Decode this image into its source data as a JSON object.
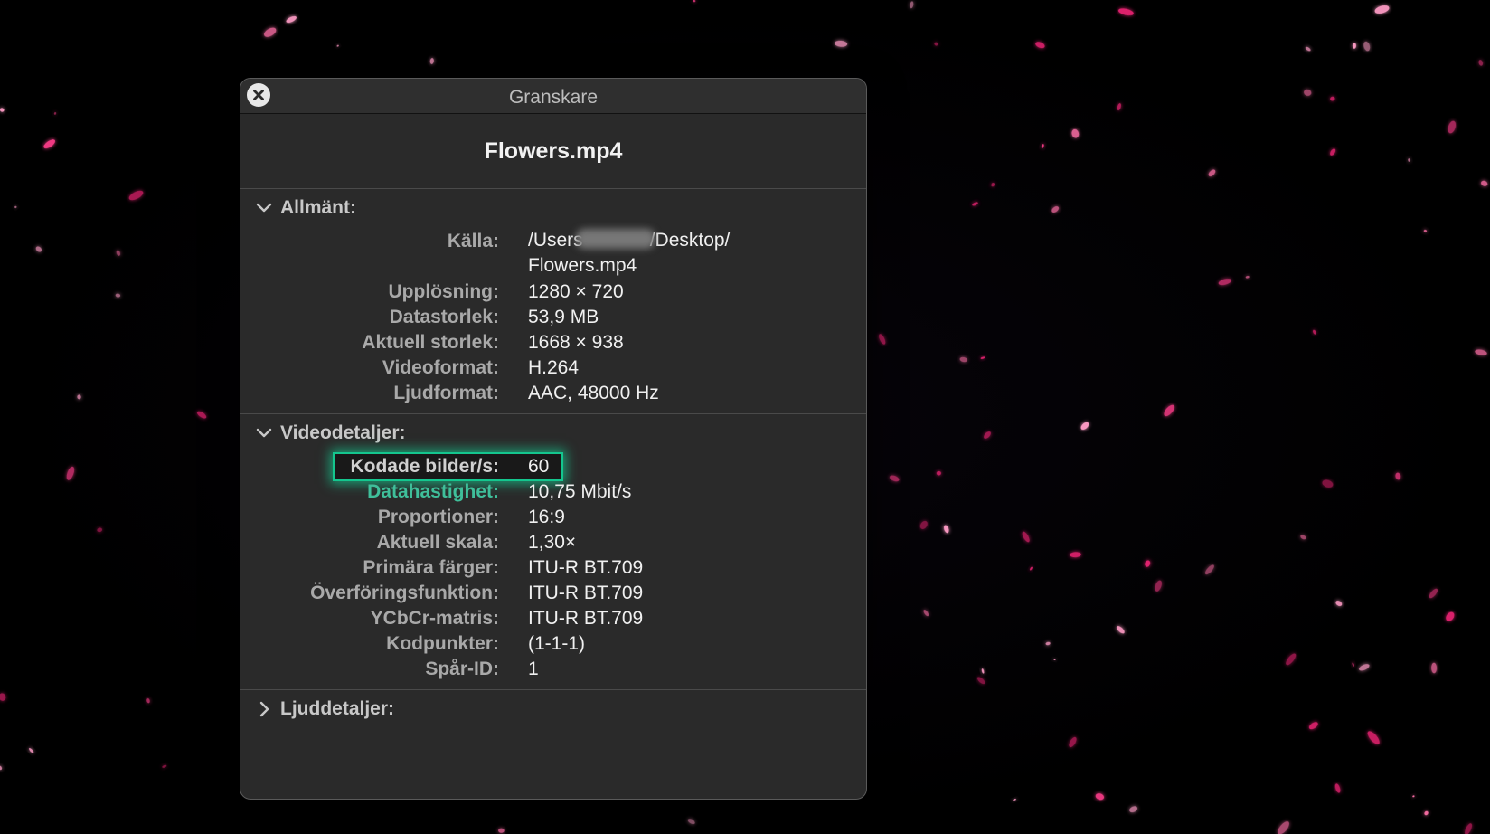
{
  "window": {
    "title": "Granskare",
    "file_name": "Flowers.mp4"
  },
  "general": {
    "title": "Allmänt:",
    "source_label": "Källa:",
    "source_line1_prefix": "/Users",
    "source_line1_suffix": "/Desktop/",
    "source_line2": "Flowers.mp4",
    "rows": [
      {
        "label": "Upplösning:",
        "value": "1280 × 720"
      },
      {
        "label": "Datastorlek:",
        "value": "53,9 MB"
      },
      {
        "label": "Aktuell storlek:",
        "value": "1668 × 938"
      },
      {
        "label": "Videoformat:",
        "value": "H.264"
      },
      {
        "label": "Ljudformat:",
        "value": "AAC, 48000 Hz"
      }
    ]
  },
  "video": {
    "title": "Videodetaljer:",
    "rows": [
      {
        "label": "Kodade bilder/s:",
        "value": "60"
      },
      {
        "label": "Datahastighet:",
        "value": "10,75 Mbit/s"
      },
      {
        "label": "Proportioner:",
        "value": "16:9"
      },
      {
        "label": "Aktuell skala:",
        "value": "1,30×"
      },
      {
        "label": "Primära färger:",
        "value": "ITU-R BT.709"
      },
      {
        "label": "Överföringsfunktion:",
        "value": "ITU-R BT.709"
      },
      {
        "label": "YCbCr-matris:",
        "value": "ITU-R BT.709"
      },
      {
        "label": "Kodpunkter:",
        "value": "(1-1-1)"
      },
      {
        "label": "Spår-ID:",
        "value": "1"
      }
    ]
  },
  "audio": {
    "title": "Ljuddetaljer:"
  },
  "colors": {
    "window_bg": "#2a2a2a",
    "highlight": "#14c68e",
    "petal": "#ff3d8b"
  }
}
